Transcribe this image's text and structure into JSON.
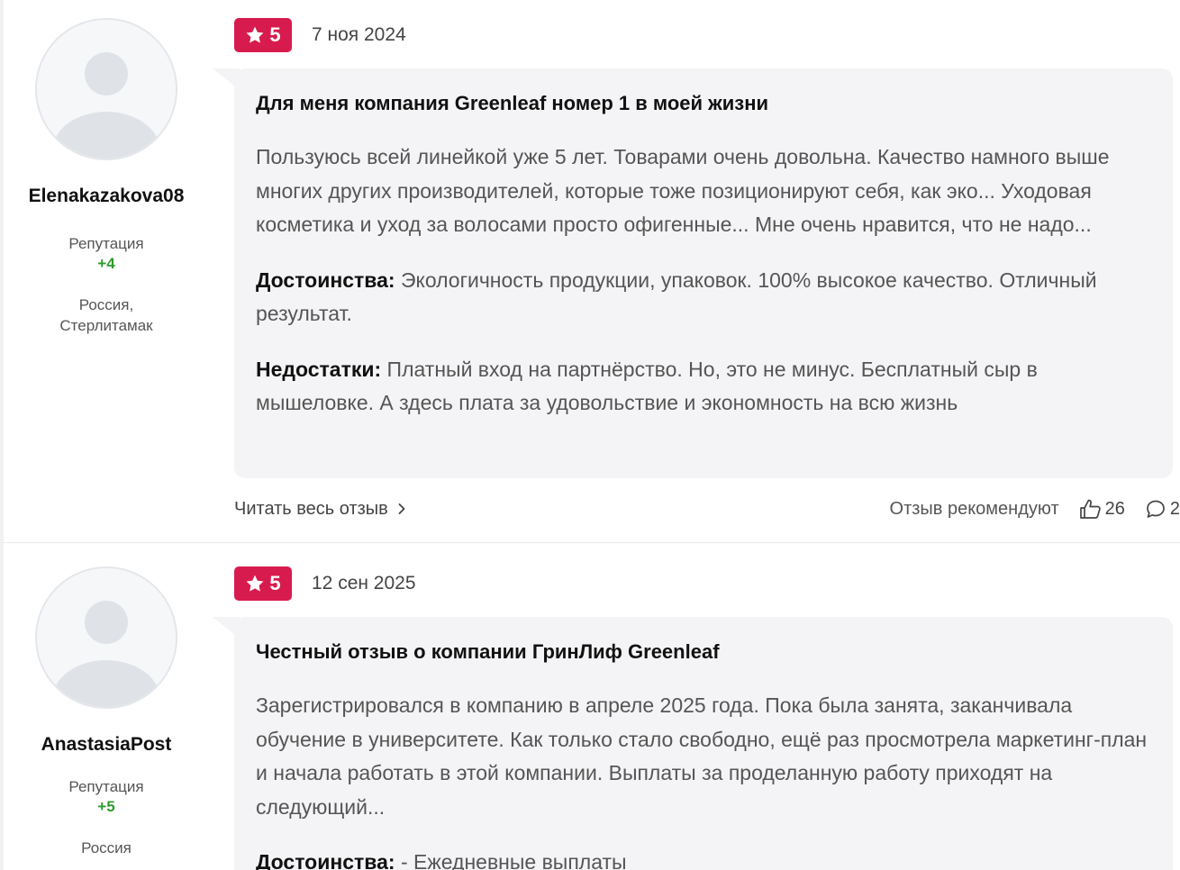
{
  "reviews": [
    {
      "author": {
        "username": "Elenakazakova08",
        "reputation_label": "Репутация",
        "reputation_value": "+4",
        "location_line1": "Россия,",
        "location_line2": "Стерлитамак"
      },
      "rating": "5",
      "date": "7 ноя 2024",
      "title": "Для меня компания Greenleaf номер 1 в моей жизни",
      "text": "Пользуюсь всей линейкой уже 5 лет. Товарами очень довольна. Качество намного выше многих других производителей, которые тоже позиционируют себя, как эко... Уходовая косметика и уход за волосами просто офигенные... Мне очень нравится, что не надо...",
      "pros_label": "Достоинства:",
      "pros_text": " Экологичность продукции, упаковок. 100% высокое качество. Отличный результат.",
      "cons_label": "Недостатки:",
      "cons_text": " Платный вход на партнёрство. Но, это не минус. Бесплатный сыр в мышеловке. А здесь плата за удовольствие и экономность на всю жизнь",
      "read_more": "Читать весь отзыв",
      "recommend_label": "Отзыв рекомендуют",
      "likes": "26",
      "comments": "2"
    },
    {
      "author": {
        "username": "AnastasiaPost",
        "reputation_label": "Репутация",
        "reputation_value": "+5",
        "location_line1": "Россия"
      },
      "rating": "5",
      "date": "12 сен 2025",
      "title": "Честный отзыв о компании ГринЛиф Greenleaf",
      "text": "Зарегистрировался в компанию в апреле 2025 года. Пока была занята, заканчивала обучение в университете. Как только стало свободно, ещё раз просмотрела маркетинг-план и начала работать в этой компании. Выплаты за проделанную работу приходят на следующий...",
      "pros_label": "Достоинства:",
      "pros_text": " - Ежедневные выплаты"
    }
  ],
  "colors": {
    "rating_badge": "#d81b4e",
    "reputation_positive": "#2e9b2e",
    "card_background": "#f4f4f6"
  },
  "icons": {
    "rating": "star-icon",
    "read_more": "chevron-right-icon",
    "likes": "thumbs-up-icon",
    "comments": "comment-icon"
  }
}
